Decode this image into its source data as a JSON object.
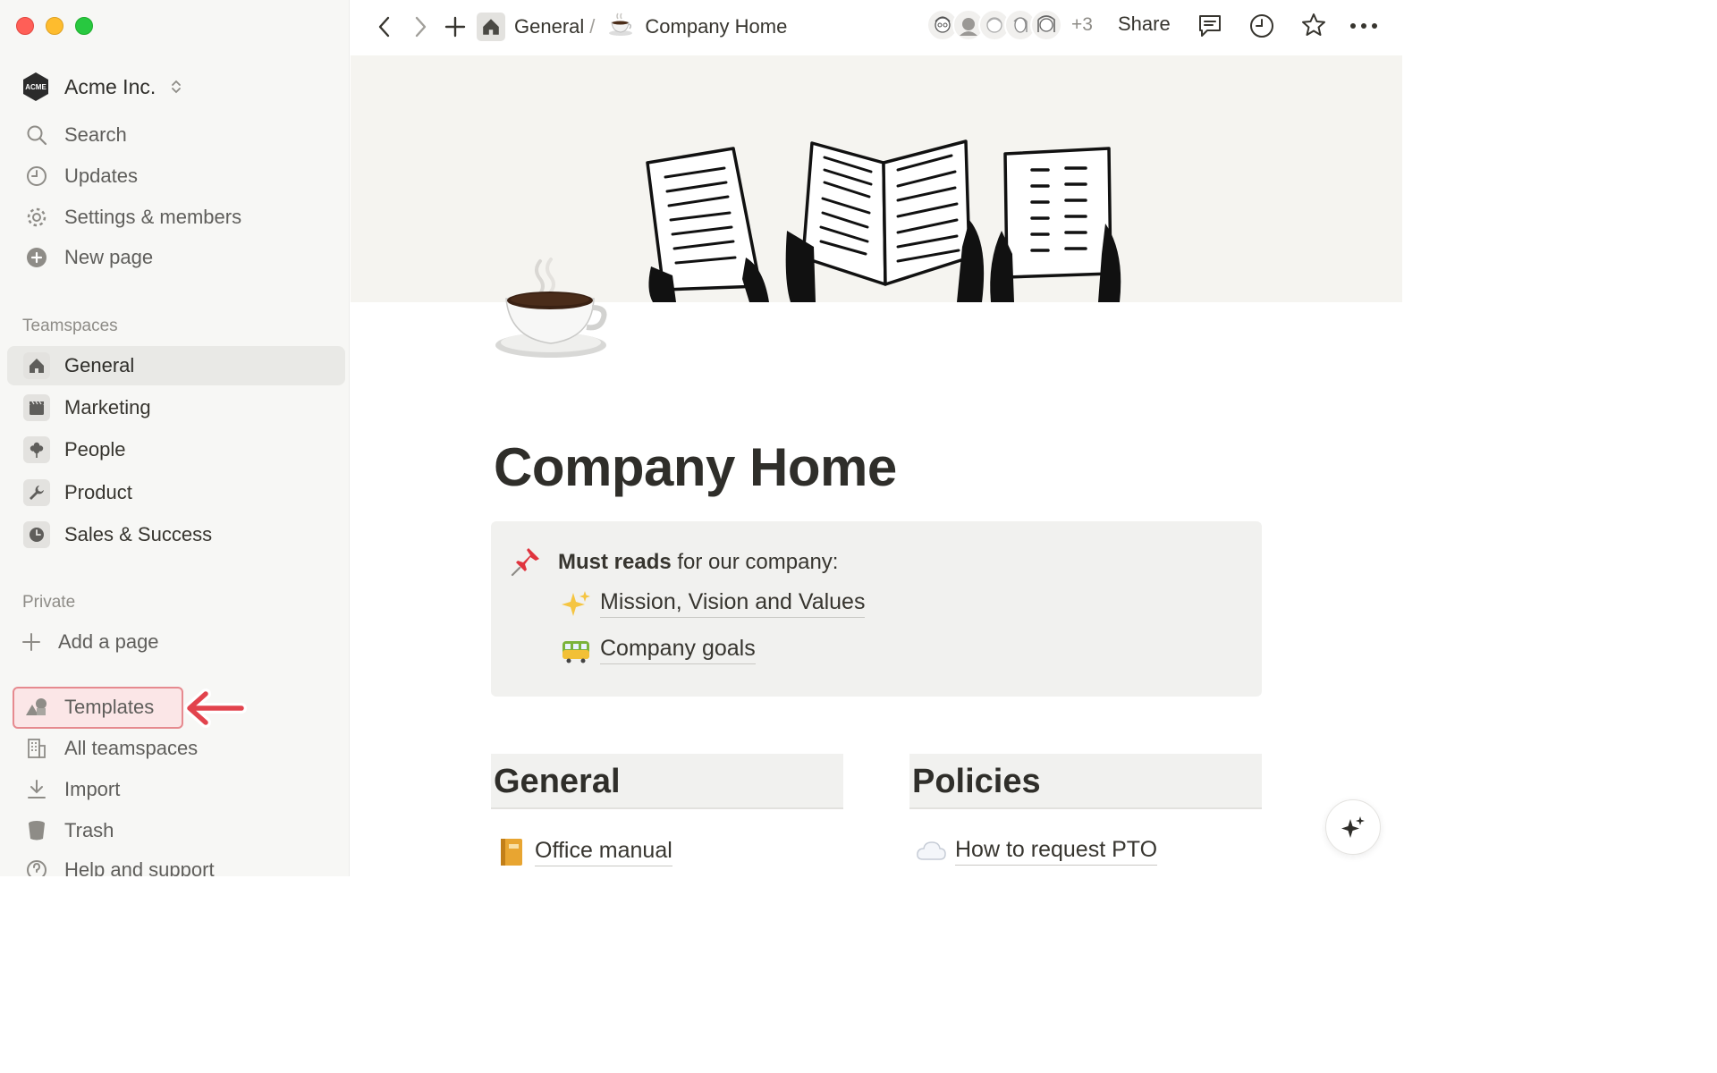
{
  "workspace": {
    "name": "Acme Inc.",
    "logo_text": "ACME"
  },
  "sidebar": {
    "top_items": [
      {
        "label": "Search",
        "icon": "search-icon"
      },
      {
        "label": "Updates",
        "icon": "clock-icon"
      },
      {
        "label": "Settings & members",
        "icon": "gear-icon"
      },
      {
        "label": "New page",
        "icon": "plus-circle-icon"
      }
    ],
    "teamspaces_label": "Teamspaces",
    "teamspaces": [
      {
        "label": "General",
        "icon": "house-icon",
        "active": true
      },
      {
        "label": "Marketing",
        "icon": "clapperboard-icon"
      },
      {
        "label": "People",
        "icon": "flower-icon"
      },
      {
        "label": "Product",
        "icon": "wrench-icon"
      },
      {
        "label": "Sales & Success",
        "icon": "pie-clock-icon"
      }
    ],
    "private_label": "Private",
    "add_page_label": "Add a page",
    "bottom_items": [
      {
        "label": "Templates",
        "icon": "shapes-icon",
        "highlighted": true
      },
      {
        "label": "All teamspaces",
        "icon": "building-icon"
      },
      {
        "label": "Import",
        "icon": "download-icon"
      },
      {
        "label": "Trash",
        "icon": "trash-icon"
      },
      {
        "label": "Help and support",
        "icon": "question-icon"
      }
    ]
  },
  "topbar": {
    "breadcrumb": [
      {
        "label": "General",
        "icon": "house-icon"
      },
      {
        "label": "Company Home",
        "icon": "coffee-icon"
      }
    ],
    "breadcrumb_separator": "/",
    "extra_members": "+3",
    "share_label": "Share"
  },
  "page": {
    "title": "Company Home",
    "callout": {
      "icon": "pushpin-icon",
      "bold": "Must reads",
      "text": " for our company:",
      "links": [
        {
          "label": "Mission, Vision and Values",
          "icon": "sparkles-icon"
        },
        {
          "label": "Company goals",
          "icon": "tram-icon"
        }
      ]
    },
    "columns": [
      {
        "heading": "General",
        "item": {
          "label": "Office manual",
          "icon": "notebook-icon"
        }
      },
      {
        "heading": "Policies",
        "item": {
          "label": "How to request PTO",
          "icon": "cloud-icon"
        }
      }
    ]
  },
  "colors": {
    "accent_highlight": "#e68a8f",
    "sidebar_bg": "#f7f7f5",
    "callout_bg": "#f1f1ef"
  }
}
